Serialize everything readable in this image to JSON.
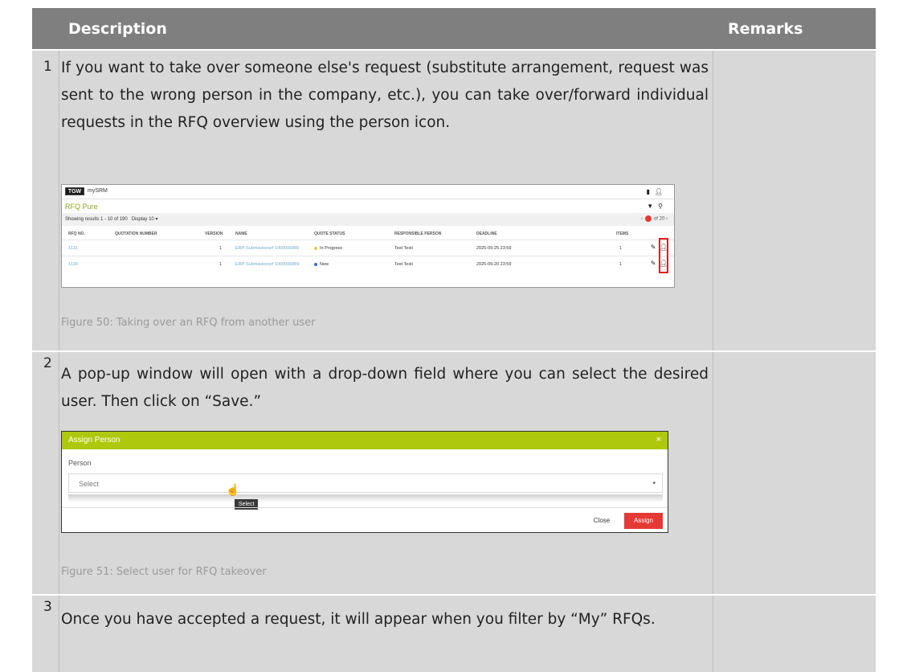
{
  "header": {
    "description": "Description",
    "remarks": "Remarks"
  },
  "rows": [
    {
      "number": "1",
      "text": "If you want to take over someone else's request (substitute arrangement, request was sent to the wrong person in the company, etc.), you can take over/forward individual requests in the RFQ overview using the person icon.",
      "caption": "Figure 50: Taking over an RFQ from another user"
    },
    {
      "number": "2",
      "text": "A pop-up window will open with a drop-down field where you can select the desired user. Then click on “Save.”",
      "caption": "Figure 51: Select user for RFQ takeover"
    },
    {
      "number": "3",
      "text": "Once you have accepted a request, it will appear when you filter by “My” RFQs."
    }
  ],
  "fig50": {
    "logo": "TGW",
    "app_name": "mySRM",
    "page_title": "RFQ Pure",
    "results": "Showing results 1 - 10 of 190",
    "display_label": "Display",
    "display_value": "10",
    "pager_of": "of 20",
    "columns": [
      "RFQ NO.",
      "QUOTATION NUMBER",
      "VERSION",
      "NAME",
      "QUOTE STATUS",
      "RESPONSIBLE PERSON",
      "DEADLINE",
      "ITEMS"
    ],
    "rows": [
      {
        "rfq": "1131",
        "version": "1",
        "name": "ERP-Submissions# 1000006860",
        "status": "In Progress",
        "status_color": "#f2c94c",
        "person": "Test Testi",
        "deadline": "2025-09-25 23:59",
        "items": "1"
      },
      {
        "rfq": "1130",
        "version": "1",
        "name": "ERP-Submissions# 1000006859",
        "status": "New",
        "status_color": "#2f6fd6",
        "person": "Test Testi",
        "deadline": "2025-09-20 23:59",
        "items": "1"
      }
    ]
  },
  "fig51": {
    "title": "Assign Person",
    "close_glyph": "×",
    "person_label": "Person",
    "select_placeholder": "Select",
    "tooltip": "Select",
    "close_button": "Close",
    "assign_button": "Assign"
  }
}
